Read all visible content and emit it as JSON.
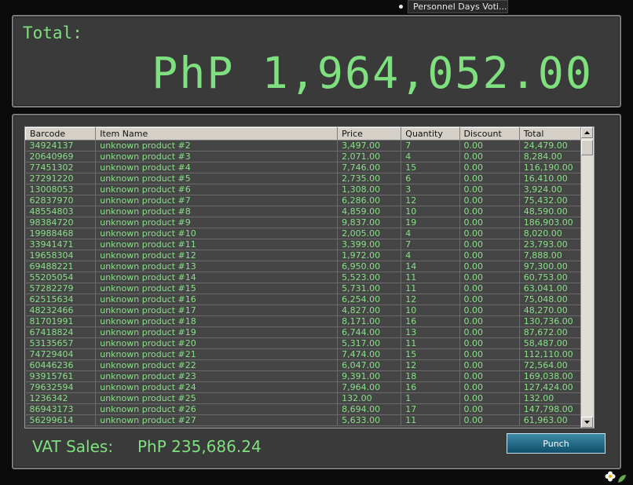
{
  "taskbar": {
    "tab_label": "Personnel Days Voti..."
  },
  "total": {
    "label": "Total:",
    "amount": "PhP 1,964,052.00"
  },
  "table": {
    "headers": [
      "Barcode",
      "Item Name",
      "Price",
      "Quantity",
      "Discount",
      "Total"
    ],
    "rows": [
      [
        "34924137",
        "unknown product #2",
        "3,497.00",
        "7",
        "0.00",
        "24,479.00"
      ],
      [
        "20640969",
        "unknown product #3",
        "2,071.00",
        "4",
        "0.00",
        "8,284.00"
      ],
      [
        "77451302",
        "unknown product #4",
        "7,746.00",
        "15",
        "0.00",
        "116,190.00"
      ],
      [
        "27291220",
        "unknown product #5",
        "2,735.00",
        "6",
        "0.00",
        "16,410.00"
      ],
      [
        "13008053",
        "unknown product #6",
        "1,308.00",
        "3",
        "0.00",
        "3,924.00"
      ],
      [
        "62837970",
        "unknown product #7",
        "6,286.00",
        "12",
        "0.00",
        "75,432.00"
      ],
      [
        "48554803",
        "unknown product #8",
        "4,859.00",
        "10",
        "0.00",
        "48,590.00"
      ],
      [
        "98384720",
        "unknown product #9",
        "9,837.00",
        "19",
        "0.00",
        "186,903.00"
      ],
      [
        "19988468",
        "unknown product #10",
        "2,005.00",
        "4",
        "0.00",
        "8,020.00"
      ],
      [
        "33941471",
        "unknown product #11",
        "3,399.00",
        "7",
        "0.00",
        "23,793.00"
      ],
      [
        "19658304",
        "unknown product #12",
        "1,972.00",
        "4",
        "0.00",
        "7,888.00"
      ],
      [
        "69488221",
        "unknown product #13",
        "6,950.00",
        "14",
        "0.00",
        "97,300.00"
      ],
      [
        "55205054",
        "unknown product #14",
        "5,523.00",
        "11",
        "0.00",
        "60,753.00"
      ],
      [
        "57282279",
        "unknown product #15",
        "5,731.00",
        "11",
        "0.00",
        "63,041.00"
      ],
      [
        "62515634",
        "unknown product #16",
        "6,254.00",
        "12",
        "0.00",
        "75,048.00"
      ],
      [
        "48232466",
        "unknown product #17",
        "4,827.00",
        "10",
        "0.00",
        "48,270.00"
      ],
      [
        "81701991",
        "unknown product #18",
        "8,171.00",
        "16",
        "0.00",
        "130,736.00"
      ],
      [
        "67418824",
        "unknown product #19",
        "6,744.00",
        "13",
        "0.00",
        "87,672.00"
      ],
      [
        "53135657",
        "unknown product #20",
        "5,317.00",
        "11",
        "0.00",
        "58,487.00"
      ],
      [
        "74729404",
        "unknown product #21",
        "7,474.00",
        "15",
        "0.00",
        "112,110.00"
      ],
      [
        "60446236",
        "unknown product #22",
        "6,047.00",
        "12",
        "0.00",
        "72,564.00"
      ],
      [
        "93915761",
        "unknown product #23",
        "9,391.00",
        "18",
        "0.00",
        "169,038.00"
      ],
      [
        "79632594",
        "unknown product #24",
        "7,964.00",
        "16",
        "0.00",
        "127,424.00"
      ],
      [
        "1236342",
        "unknown product #25",
        "132.00",
        "1",
        "0.00",
        "132.00"
      ],
      [
        "86943173",
        "unknown product #26",
        "8,694.00",
        "17",
        "0.00",
        "147,798.00"
      ],
      [
        "56299614",
        "unknown product #27",
        "5,633.00",
        "11",
        "0.00",
        "61,963.00"
      ]
    ]
  },
  "vat": {
    "label": "VAT Sales:",
    "value": "PhP 235,686.24"
  },
  "punch_button": {
    "label": "Punch"
  },
  "colors": {
    "accent_green": "#7fe07f",
    "panel_bg": "#3a3a3a",
    "button_blue": "#1f6a88"
  }
}
